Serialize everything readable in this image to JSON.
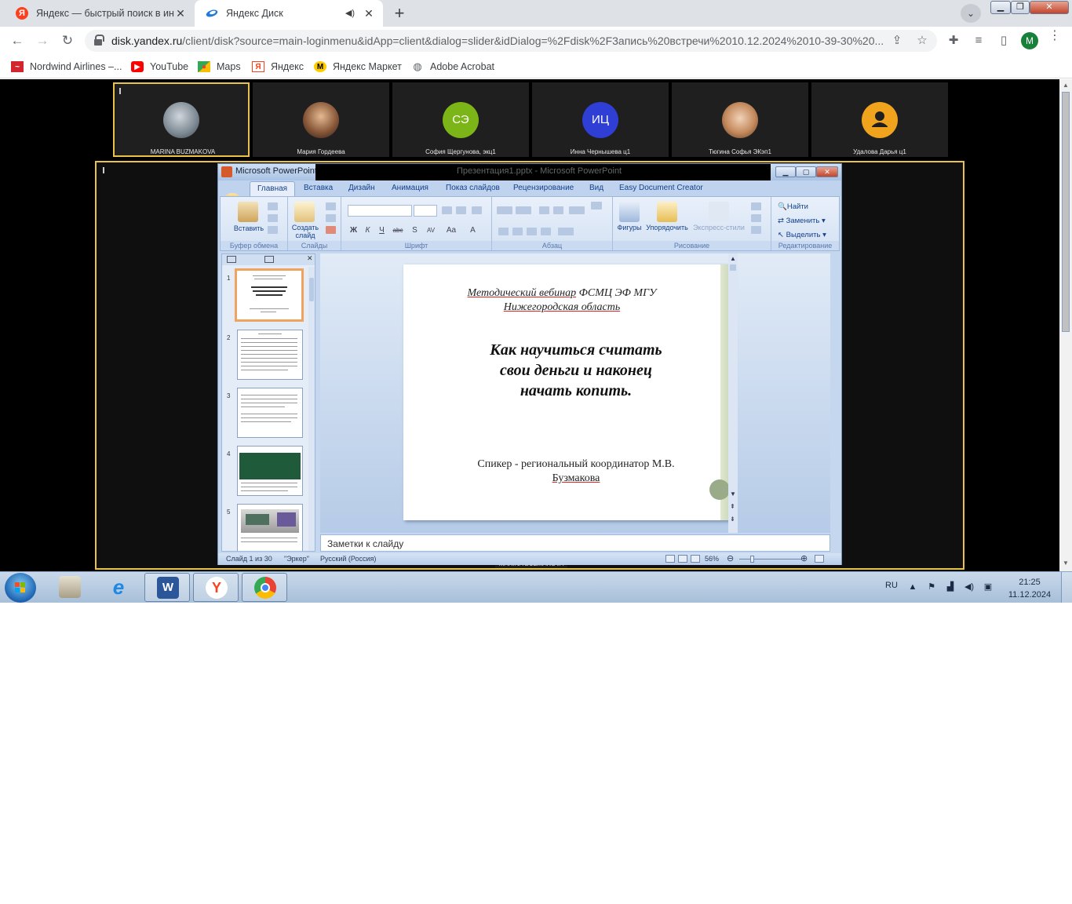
{
  "browser": {
    "tabs": [
      {
        "title": "Яндекс — быстрый поиск в инт",
        "favicon": "yandex-icon"
      },
      {
        "title": "Яндекс Диск",
        "favicon": "yandex-disk-icon"
      }
    ],
    "url_host": "disk.yandex.ru",
    "url_path": "/client/disk?source=main-loginmenu&idApp=client&dialog=slider&idDialog=%2Fdisk%2F3апись%20встречи%2010.12.2024%2010-39-30%20...",
    "profile_initial": "M",
    "bookmarks": [
      {
        "label": "Nordwind Airlines –...",
        "icon": "nordwind-icon"
      },
      {
        "label": "YouTube",
        "icon": "youtube-icon"
      },
      {
        "label": "Maps",
        "icon": "maps-icon"
      },
      {
        "label": "Яндекс",
        "icon": "yandex-icon"
      },
      {
        "label": "Яндекс Маркет",
        "icon": "yandex-market-icon"
      },
      {
        "label": "Adobe Acrobat",
        "icon": "globe-icon"
      }
    ]
  },
  "meeting": {
    "participants": [
      {
        "name": "MARINA BUZMAKOVA",
        "avatar": "photo",
        "active": true
      },
      {
        "name": "Мария Гордеева",
        "avatar": "photo"
      },
      {
        "name": "София Щергунова, экц1",
        "avatar": "СЭ",
        "color": "#7cb518"
      },
      {
        "name": "Инна Чернышева ц1",
        "avatar": "ИЦ",
        "color": "#2f3fd6"
      },
      {
        "name": "Тюгина Софья ЭКэп1",
        "avatar": "photo"
      },
      {
        "name": "Удалова Дарья ц1",
        "avatar": "person-icon",
        "color": "#f0a41e"
      }
    ],
    "speaker_label": "MARINA BUZMAKOVA"
  },
  "powerpoint": {
    "window_title": "Microsoft PowerPoint -",
    "hidden_title": "Презентация1.pptx - Microsoft PowerPoint",
    "ribbon_tabs": [
      "Главная",
      "Вставка",
      "Дизайн",
      "Анимация",
      "Показ слайдов",
      "Рецензирование",
      "Вид",
      "Easy Document Creator"
    ],
    "groups": {
      "clipboard": "Буфер обмена",
      "slides": "Слайды",
      "font": "Шрифт",
      "paragraph": "Абзац",
      "drawing": "Рисование",
      "editing": "Редактирование"
    },
    "buttons": {
      "paste": "Вставить",
      "new_slide_1": "Создать",
      "new_slide_2": "слайд",
      "shapes": "Фигуры",
      "arrange": "Упорядочить",
      "quick_styles": "Экспресс-стили",
      "find": "Найти",
      "replace": "Заменить",
      "select": "Выделить"
    },
    "format_glyphs": [
      "Ж",
      "К",
      "Ч",
      "abc",
      "S",
      "AV",
      "Aa",
      "A"
    ],
    "slide_numbers": [
      "1",
      "2",
      "3",
      "4",
      "5"
    ],
    "slide": {
      "header_line1_a": "Методический вебинар",
      "header_line1_b": " ФСМЦ ЭФ МГУ",
      "header_line2": "Нижегородская область",
      "title_line1": "Как научиться считать",
      "title_line2": "свои деньги и наконец",
      "title_line3": "начать копить.",
      "speaker_line1": "Спикер - региональный координатор М.В.",
      "speaker_line2": "Бузмакова"
    },
    "notes_placeholder": "Заметки к слайду",
    "status": {
      "slide_counter": "Слайд 1 из 30",
      "theme": "\"Эркер\"",
      "language": "Русский (Россия)",
      "zoom": "56%"
    }
  },
  "taskbar": {
    "language": "RU",
    "time": "21:25",
    "date": "11.12.2024"
  }
}
